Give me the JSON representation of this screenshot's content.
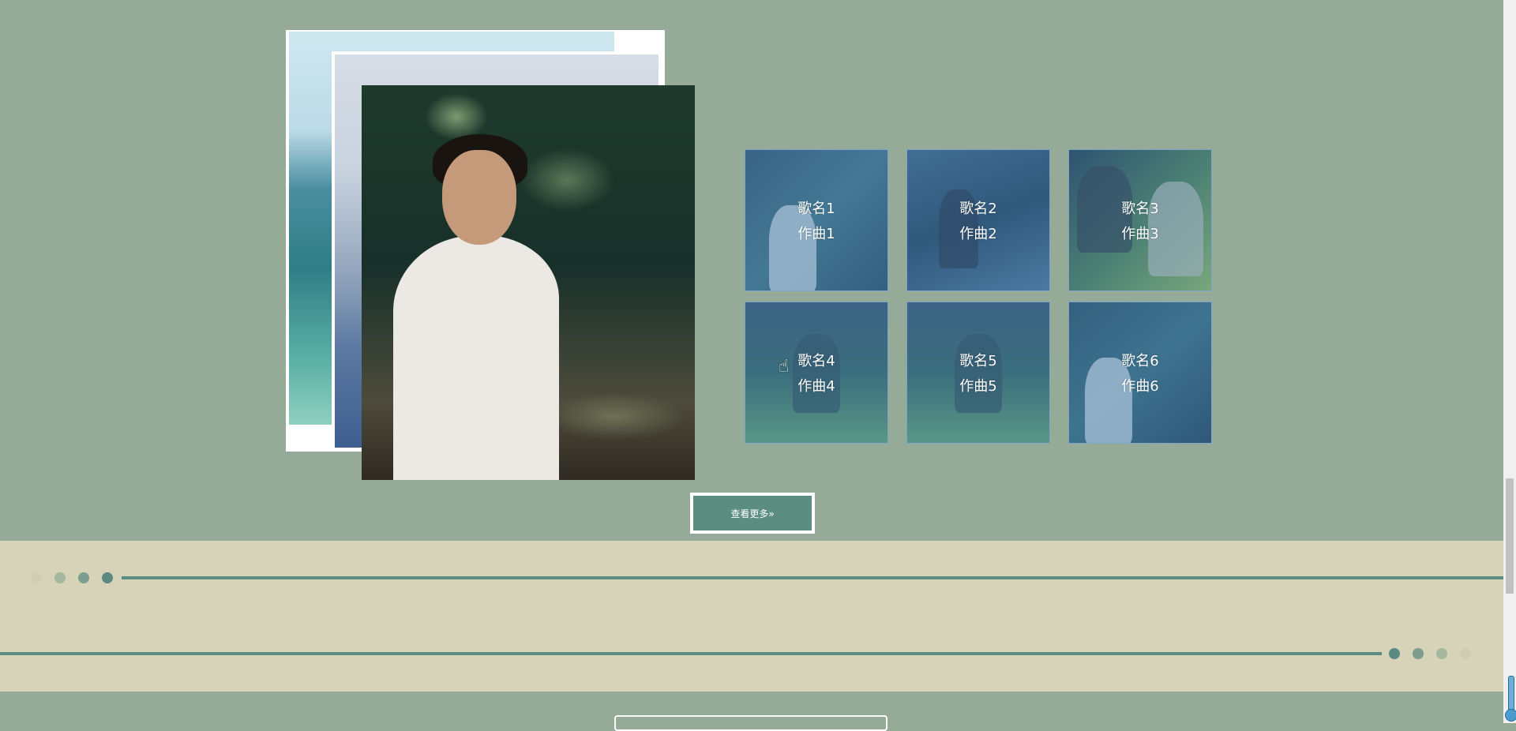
{
  "albums": [
    {
      "title": "歌名1",
      "composer": "作曲1"
    },
    {
      "title": "歌名2",
      "composer": "作曲2"
    },
    {
      "title": "歌名3",
      "composer": "作曲3"
    },
    {
      "title": "歌名4",
      "composer": "作曲4"
    },
    {
      "title": "歌名5",
      "composer": "作曲5"
    },
    {
      "title": "歌名6",
      "composer": "作曲6"
    }
  ],
  "more_button": {
    "label": "查看更多»"
  },
  "colors": {
    "page_bg": "#96ab97",
    "band_bg": "#d6d3b9",
    "accent": "#5b8a80",
    "album_overlay": "#4a8bc4"
  },
  "icons": [
    "cursor-hand-icon",
    "scroll-thermometer-icon"
  ]
}
